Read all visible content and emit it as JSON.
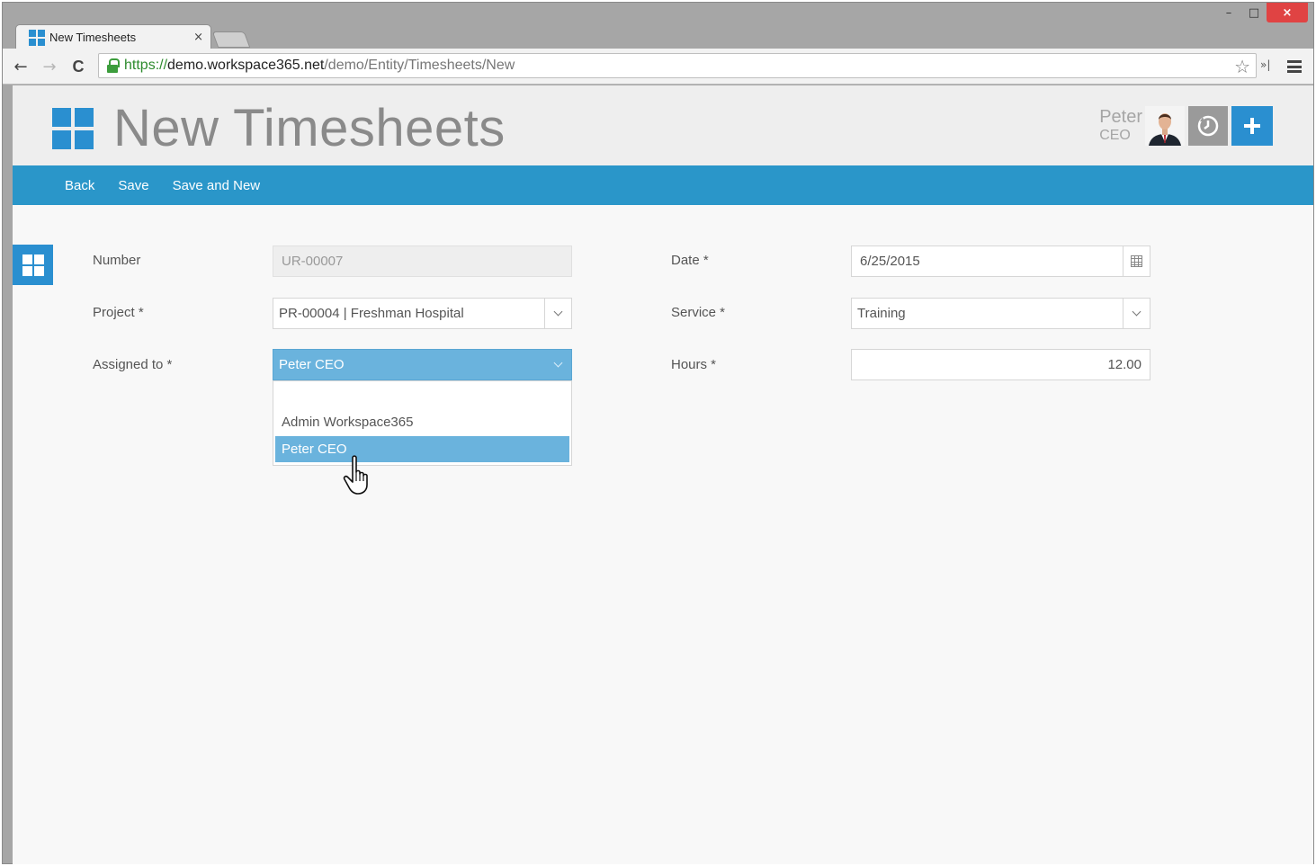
{
  "browser": {
    "tab_title": "New Timesheets",
    "tab_close": "×",
    "url_scheme": "https://",
    "url_host": "demo.workspace365.net",
    "url_path": "/demo/Entity/Timesheets/New",
    "back_glyph": "←",
    "forward_glyph": "→",
    "reload_glyph": "C",
    "star_glyph": "☆",
    "extensions_glyph": "»|",
    "window_minimize": "–",
    "window_maximize": "□",
    "window_close": "×"
  },
  "header": {
    "title": "New Timesheets",
    "user_name": "Peter",
    "user_role": "CEO"
  },
  "commands": {
    "back_label": "Back",
    "save_label": "Save",
    "save_new_label": "Save and New"
  },
  "form": {
    "number": {
      "label": "Number",
      "value": "UR-00007"
    },
    "project": {
      "label": "Project *",
      "value": "PR-00004 | Freshman Hospital"
    },
    "assigned_to": {
      "label": "Assigned to *",
      "value": "Peter CEO",
      "options": [
        "Admin Workspace365",
        "Peter CEO"
      ],
      "highlighted_option": "Peter CEO"
    },
    "date": {
      "label": "Date *",
      "value": "6/25/2015"
    },
    "service": {
      "label": "Service *",
      "value": "Training"
    },
    "hours": {
      "label": "Hours *",
      "value": "12.00"
    }
  },
  "colors": {
    "accent": "#2a8fd0",
    "commandbar": "#2a96c9",
    "selection": "#6ab3dd",
    "secure_green": "#3c9d3c"
  },
  "icons": {
    "app_logo": "windows-tiles-icon",
    "history": "clock-history-icon",
    "add": "plus-icon",
    "date_picker": "calendar-icon",
    "dropdown": "chevron-down-icon",
    "cursor": "hand-pointer-icon"
  }
}
